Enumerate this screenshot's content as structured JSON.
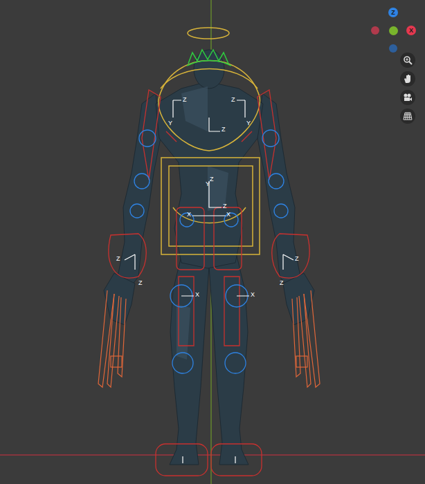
{
  "viewport": {
    "navigation_gizmo": {
      "axes": [
        {
          "label": "Z",
          "color": "#2f83e3"
        },
        {
          "label": "X",
          "color": "#e5384f"
        }
      ]
    },
    "bone_axis_labels": [
      {
        "label": "Z"
      },
      {
        "label": "Z"
      },
      {
        "label": "Y"
      },
      {
        "label": "Y"
      },
      {
        "label": "Z"
      },
      {
        "label": "Z"
      },
      {
        "label": "X"
      },
      {
        "label": "X"
      },
      {
        "label": "Z"
      },
      {
        "label": "Z"
      },
      {
        "label": "Z"
      },
      {
        "label": "Z"
      },
      {
        "label": "X"
      },
      {
        "label": "X"
      },
      {
        "label": "Y"
      },
      {
        "label": "Z"
      }
    ]
  }
}
